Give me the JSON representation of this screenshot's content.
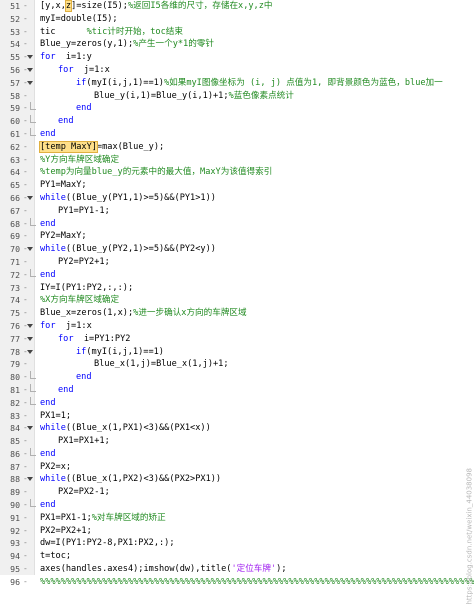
{
  "editor": {
    "lines": [
      {
        "n": "51",
        "indent": 0,
        "segs": [
          [
            "",
            "[y,x,"
          ],
          [
            "hl",
            "z"
          ],
          [
            "",
            "]=size(I5);"
          ],
          [
            "cm",
            "%返回I5各维的尺寸，存储在x,y,z中"
          ]
        ]
      },
      {
        "n": "52",
        "indent": 0,
        "segs": [
          [
            "",
            "myI=double(I5);"
          ]
        ]
      },
      {
        "n": "53",
        "indent": 0,
        "segs": [
          [
            "",
            "tic      "
          ],
          [
            "cm",
            "%tic计时开始，toc结束"
          ]
        ]
      },
      {
        "n": "54",
        "indent": 0,
        "segs": [
          [
            "",
            "Blue_y=zeros(y,1);"
          ],
          [
            "cm",
            "%产生一个y*1的零针"
          ]
        ]
      },
      {
        "n": "55",
        "indent": 0,
        "fold": "open",
        "segs": [
          [
            "kw",
            "for"
          ],
          [
            "",
            "  i=1:y"
          ]
        ]
      },
      {
        "n": "56",
        "indent": 1,
        "fold": "open",
        "segs": [
          [
            "kw",
            "for"
          ],
          [
            "",
            "  j=1:x"
          ]
        ]
      },
      {
        "n": "57",
        "indent": 2,
        "fold": "open",
        "segs": [
          [
            "kw",
            "if"
          ],
          [
            "",
            "(myI(i,j,1)==1)"
          ],
          [
            "cm",
            "%如果myI图像坐标为 (i, j) 点值为1, 即背景颜色为蓝色，blue加一"
          ]
        ]
      },
      {
        "n": "58",
        "indent": 3,
        "segs": [
          [
            "",
            "Blue_y(i,1)=Blue_y(i,1)+1;"
          ],
          [
            "cm",
            "%蓝色像素点统计"
          ]
        ]
      },
      {
        "n": "59",
        "indent": 2,
        "end": true,
        "segs": [
          [
            "kw",
            "end"
          ]
        ]
      },
      {
        "n": "60",
        "indent": 1,
        "end": true,
        "segs": [
          [
            "kw",
            "end"
          ]
        ]
      },
      {
        "n": "61",
        "indent": 0,
        "end": true,
        "segs": [
          [
            "kw",
            "end"
          ]
        ]
      },
      {
        "n": "62",
        "indent": 0,
        "segs": [
          [
            "hl",
            "[temp MaxY]"
          ],
          [
            "",
            "=max(Blue_y);"
          ]
        ]
      },
      {
        "n": "63",
        "indent": 0,
        "segs": [
          [
            "cm",
            "%Y方向车牌区域确定"
          ]
        ]
      },
      {
        "n": "64",
        "indent": 0,
        "segs": [
          [
            "cm",
            "%temp为向量blue_y的元素中的最大值，MaxY为该值得索引"
          ]
        ]
      },
      {
        "n": "65",
        "indent": 0,
        "segs": [
          [
            "",
            "PY1=MaxY;"
          ]
        ]
      },
      {
        "n": "66",
        "indent": 0,
        "fold": "open",
        "segs": [
          [
            "kw",
            "while"
          ],
          [
            "",
            "((Blue_y(PY1,1)>=5)&&(PY1>1))"
          ]
        ]
      },
      {
        "n": "67",
        "indent": 1,
        "segs": [
          [
            "",
            "PY1=PY1-1;"
          ]
        ]
      },
      {
        "n": "68",
        "indent": 0,
        "end": true,
        "segs": [
          [
            "kw",
            "end"
          ]
        ]
      },
      {
        "n": "69",
        "indent": 0,
        "segs": [
          [
            "",
            "PY2=MaxY;"
          ]
        ]
      },
      {
        "n": "70",
        "indent": 0,
        "fold": "open",
        "segs": [
          [
            "kw",
            "while"
          ],
          [
            "",
            "((Blue_y(PY2,1)>=5)&&(PY2<y))"
          ]
        ]
      },
      {
        "n": "71",
        "indent": 1,
        "segs": [
          [
            "",
            "PY2=PY2+1;"
          ]
        ]
      },
      {
        "n": "72",
        "indent": 0,
        "end": true,
        "segs": [
          [
            "kw",
            "end"
          ]
        ]
      },
      {
        "n": "73",
        "indent": 0,
        "segs": [
          [
            "",
            "IY=I(PY1:PY2,:,:);"
          ]
        ]
      },
      {
        "n": "74",
        "indent": 0,
        "segs": [
          [
            "cm",
            "%X方向车牌区域确定"
          ]
        ]
      },
      {
        "n": "75",
        "indent": 0,
        "segs": [
          [
            "",
            "Blue_x=zeros(1,x);"
          ],
          [
            "cm",
            "%进一步确认x方向的车牌区域"
          ]
        ]
      },
      {
        "n": "76",
        "indent": 0,
        "fold": "open",
        "segs": [
          [
            "kw",
            "for"
          ],
          [
            "",
            "  j=1:x"
          ]
        ]
      },
      {
        "n": "77",
        "indent": 1,
        "fold": "open",
        "segs": [
          [
            "kw",
            "for"
          ],
          [
            "",
            "  i=PY1:PY2"
          ]
        ]
      },
      {
        "n": "78",
        "indent": 2,
        "fold": "open",
        "segs": [
          [
            "kw",
            "if"
          ],
          [
            "",
            "(myI(i,j,1)==1)"
          ]
        ]
      },
      {
        "n": "79",
        "indent": 3,
        "segs": [
          [
            "",
            "Blue_x(1,j)=Blue_x(1,j)+1;"
          ]
        ]
      },
      {
        "n": "80",
        "indent": 2,
        "end": true,
        "segs": [
          [
            "kw",
            "end"
          ]
        ]
      },
      {
        "n": "81",
        "indent": 1,
        "end": true,
        "segs": [
          [
            "kw",
            "end"
          ]
        ]
      },
      {
        "n": "82",
        "indent": 0,
        "end": true,
        "segs": [
          [
            "kw",
            "end"
          ]
        ]
      },
      {
        "n": "83",
        "indent": 0,
        "segs": [
          [
            "",
            "PX1=1;"
          ]
        ]
      },
      {
        "n": "84",
        "indent": 0,
        "fold": "open",
        "segs": [
          [
            "kw",
            "while"
          ],
          [
            "",
            "((Blue_x(1,PX1)<3)&&(PX1<x))"
          ]
        ]
      },
      {
        "n": "85",
        "indent": 1,
        "segs": [
          [
            "",
            "PX1=PX1+1;"
          ]
        ]
      },
      {
        "n": "86",
        "indent": 0,
        "end": true,
        "segs": [
          [
            "kw",
            "end"
          ]
        ]
      },
      {
        "n": "87",
        "indent": 0,
        "segs": [
          [
            "",
            "PX2=x;"
          ]
        ]
      },
      {
        "n": "88",
        "indent": 0,
        "fold": "open",
        "segs": [
          [
            "kw",
            "while"
          ],
          [
            "",
            "((Blue_x(1,PX2)<3)&&(PX2>PX1))"
          ]
        ]
      },
      {
        "n": "89",
        "indent": 1,
        "segs": [
          [
            "",
            "PX2=PX2-1;"
          ]
        ]
      },
      {
        "n": "90",
        "indent": 0,
        "end": true,
        "segs": [
          [
            "kw",
            "end"
          ]
        ]
      },
      {
        "n": "91",
        "indent": 0,
        "segs": [
          [
            "",
            "PX1=PX1-1;"
          ],
          [
            "cm",
            "%对车牌区域的矫正"
          ]
        ]
      },
      {
        "n": "92",
        "indent": 0,
        "segs": [
          [
            "",
            "PX2=PX2+1;"
          ]
        ]
      },
      {
        "n": "93",
        "indent": 0,
        "segs": [
          [
            "",
            "dw=I(PY1:PY2-8,PX1:PX2,:);"
          ]
        ]
      },
      {
        "n": "94",
        "indent": 0,
        "segs": [
          [
            "",
            "t=toc;"
          ]
        ]
      },
      {
        "n": "95",
        "indent": 0,
        "segs": [
          [
            "",
            "axes(handles.axes4);imshow(dw),title("
          ],
          [
            "st",
            "'定位车牌'"
          ],
          [
            "",
            ");"
          ]
        ]
      },
      {
        "n": "96",
        "indent": 0,
        "segs": [
          [
            "cm",
            "%%%%%%%%%%%%%%%%%%%%%%%%%%%%%%%%%%%%%%%%%%%%%%%%%%%%%%%%%%%%%%%%%%%%%%%%%%%%%%%%%%%%%%"
          ]
        ]
      }
    ],
    "watermark": "https://blog.csdn.net/weixin_44038098"
  }
}
